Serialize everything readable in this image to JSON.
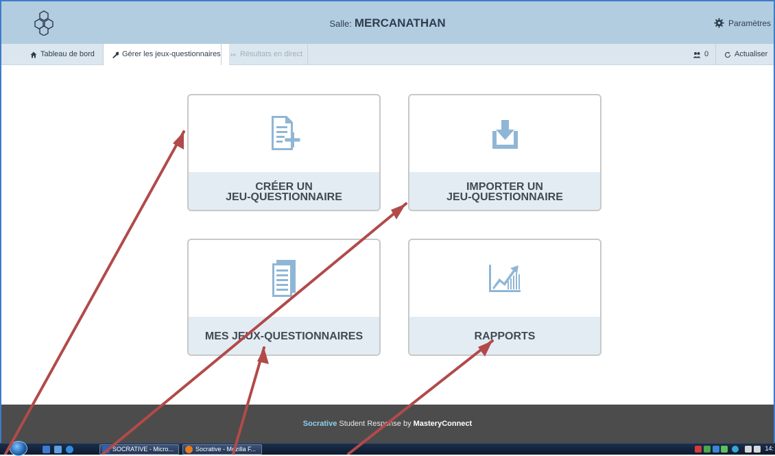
{
  "header": {
    "room_label": "Salle:",
    "room_name": "MERCANATHAN",
    "settings_label": "Paramètres",
    "logo_icon": "hexagon-network-icon"
  },
  "nav": {
    "items": [
      {
        "label": "Tableau de bord",
        "icon": "home-icon",
        "state": "normal"
      },
      {
        "label": "Gérer les jeux-questionnaires",
        "icon": "wrench-icon",
        "state": "active"
      },
      {
        "label": "Résultats en direct",
        "icon": "broadcast-icon",
        "state": "disabled"
      }
    ],
    "students_count": "0",
    "refresh_label": "Actualiser"
  },
  "tiles": [
    {
      "line1": "CRÉER UN",
      "line2": "JEU-QUESTIONNAIRE",
      "icon": "create-document-icon"
    },
    {
      "line1": "IMPORTER UN",
      "line2": "JEU-QUESTIONNAIRE",
      "icon": "import-download-icon"
    },
    {
      "line1": "MES JEUX-QUESTIONNAIRES",
      "line2": "",
      "icon": "documents-icon"
    },
    {
      "line1": "RAPPORTS",
      "line2": "",
      "icon": "chart-growth-icon"
    }
  ],
  "footer": {
    "brand": "Socrative",
    "middle": " Student Response by ",
    "company": "MasteryConnect"
  },
  "taskbar": {
    "buttons": [
      {
        "label": "SOCRATIVE - Micro...",
        "icon": "word-icon"
      },
      {
        "label": "Socrative - Mozilla F...",
        "icon": "firefox-icon"
      }
    ],
    "clock": "14:"
  },
  "colors": {
    "header_bg": "#b3cde0",
    "nav_bg": "#dbe6ee",
    "tile_label_bg": "#e3ecf3",
    "icon_blue": "#8fb6d6",
    "footer_bg": "#4c4c4c",
    "arrow_red": "#b24a4a"
  }
}
